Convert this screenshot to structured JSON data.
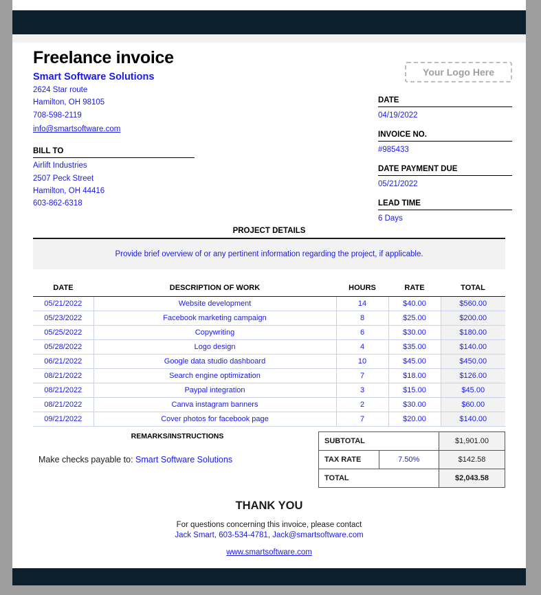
{
  "document": {
    "title": "Freelance invoice",
    "company": "Smart Software Solutions",
    "address_1": "2624 Star route",
    "address_2": "Hamilton, OH 98105",
    "phone": "708-598-2119",
    "email": "info@smartsoftware.com",
    "logo_placeholder": "Your Logo Here"
  },
  "bill_to": {
    "heading": "BILL TO",
    "name": "Airlift Industries",
    "address_1": "2507 Peck Street",
    "address_2": "Hamilton, OH 44416",
    "phone": "603-862-6318"
  },
  "meta": {
    "date_label": "DATE",
    "date_value": "04/19/2022",
    "invoice_no_label": "INVOICE NO.",
    "invoice_no_value": "#985433",
    "due_label": "DATE PAYMENT DUE",
    "due_value": "05/21/2022",
    "lead_time_label": "LEAD TIME",
    "lead_time_value": "6 Days"
  },
  "project_details": {
    "heading": "PROJECT DETAILS",
    "text": "Provide brief overview of or any pertinent information regarding the project, if applicable."
  },
  "table": {
    "columns": [
      "DATE",
      "DESCRIPTION OF WORK",
      "HOURS",
      "RATE",
      "TOTAL"
    ],
    "rows": [
      {
        "date": "05/21/2022",
        "description": "Website development",
        "hours": "14",
        "rate": "$40.00",
        "total": "$560.00"
      },
      {
        "date": "05/23/2022",
        "description": "Facebook marketing campaign",
        "hours": "8",
        "rate": "$25.00",
        "total": "$200.00"
      },
      {
        "date": "05/25/2022",
        "description": "Copywriting",
        "hours": "6",
        "rate": "$30.00",
        "total": "$180.00"
      },
      {
        "date": "05/28/2022",
        "description": "Logo design",
        "hours": "4",
        "rate": "$35.00",
        "total": "$140.00"
      },
      {
        "date": "06/21/2022",
        "description": "Google data studio dashboard",
        "hours": "10",
        "rate": "$45.00",
        "total": "$450.00"
      },
      {
        "date": "08/21/2022",
        "description": "Search engine optimization",
        "hours": "7",
        "rate": "$18.00",
        "total": "$126.00"
      },
      {
        "date": "08/21/2022",
        "description": "Paypal integration",
        "hours": "3",
        "rate": "$15.00",
        "total": "$45.00"
      },
      {
        "date": "08/21/2022",
        "description": "Canva instagram banners",
        "hours": "2",
        "rate": "$30.00",
        "total": "$60.00"
      },
      {
        "date": "09/21/2022",
        "description": "Cover photos for facebook page",
        "hours": "7",
        "rate": "$20.00",
        "total": "$140.00"
      }
    ]
  },
  "remarks": {
    "heading": "REMARKS/INSTRUCTIONS",
    "prefix": "Make checks payable to: ",
    "payee": "Smart Software Solutions"
  },
  "totals": {
    "subtotal_label": "SUBTOTAL",
    "subtotal_value": "$1,901.00",
    "tax_rate_label": "TAX RATE",
    "tax_rate_percent": "7.50%",
    "tax_value": "$142.58",
    "total_label": "TOTAL",
    "total_value": "$2,043.58"
  },
  "footer": {
    "thank_you": "THANK YOU",
    "contact_line": "For questions concerning this invoice, please contact",
    "contact_details": "Jack Smart, 603-534-4781, Jack@smartsoftware.com",
    "website": "www.smartsoftware.com"
  },
  "colors": {
    "accent_blue": "#1a1aee",
    "bar_navy": "#0c1f2c",
    "panel_gray": "#f2f2f2"
  }
}
